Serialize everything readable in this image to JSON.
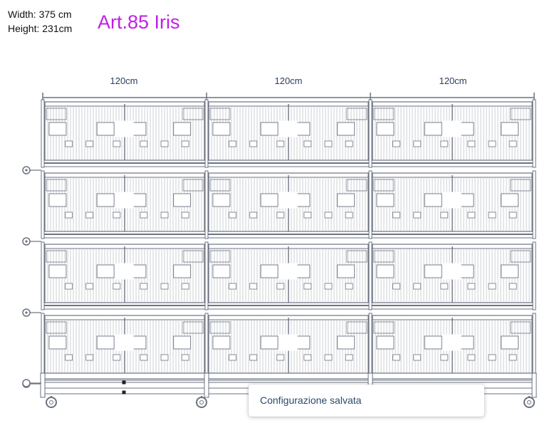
{
  "dimensions": {
    "width_text": "Width: 375 cm",
    "height_text": "Height: 231cm"
  },
  "product": {
    "title": "Art.85 Iris"
  },
  "diagram": {
    "modules": [
      {
        "width_label": "120cm"
      },
      {
        "width_label": "120cm"
      },
      {
        "width_label": "120cm"
      }
    ],
    "tiers": 4,
    "colors": {
      "title": "#c21ee6",
      "label": "#2c3e60",
      "line": "#6b7280",
      "wire": "#9aa0a8"
    }
  },
  "toast": {
    "message": "Configurazione salvata"
  }
}
